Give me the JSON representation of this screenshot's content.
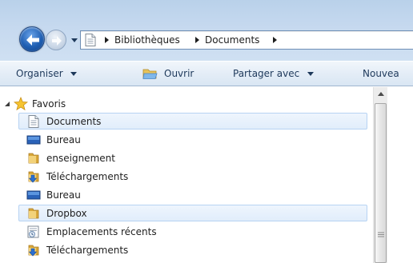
{
  "address": {
    "crumbs": [
      "Bibliothèques",
      "Documents"
    ]
  },
  "toolbar": {
    "organize": "Organiser",
    "open": "Ouvrir",
    "share": "Partager avec",
    "new_folder_partial": "Nouvea"
  },
  "navpane": {
    "favorites_label": "Favoris",
    "items": [
      {
        "label": "Documents",
        "icon": "document-icon",
        "selected": true
      },
      {
        "label": "Bureau",
        "icon": "desktop-icon",
        "selected": false
      },
      {
        "label": "enseignement",
        "icon": "folder-icon",
        "selected": false
      },
      {
        "label": "Téléchargements",
        "icon": "downloads-icon",
        "selected": false
      },
      {
        "label": "Bureau",
        "icon": "desktop-icon",
        "selected": false
      },
      {
        "label": "Dropbox",
        "icon": "folder-icon",
        "selected": true
      },
      {
        "label": "Emplacements récents",
        "icon": "recent-places-icon",
        "selected": false
      },
      {
        "label": "Téléchargements",
        "icon": "downloads-icon",
        "selected": false
      }
    ]
  },
  "colors": {
    "accent": "#1f5fb3",
    "selection": "#e1edfb",
    "toolbar_text": "#1e395b"
  }
}
